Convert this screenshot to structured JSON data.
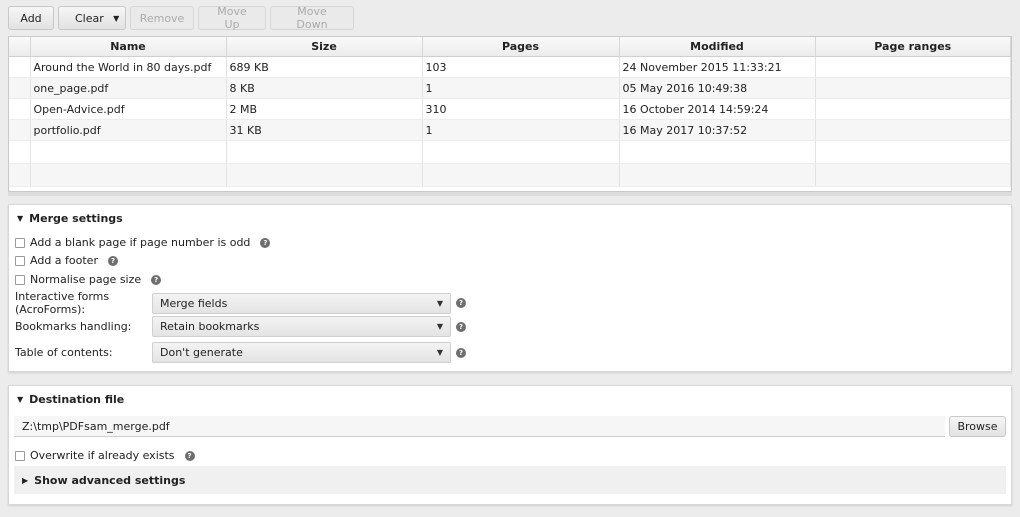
{
  "toolbar": {
    "add": "Add",
    "clear": "Clear",
    "remove": "Remove",
    "move_up": "Move Up",
    "move_down": "Move Down"
  },
  "table": {
    "columns": [
      "Name",
      "Size",
      "Pages",
      "Modified",
      "Page ranges"
    ],
    "rows": [
      {
        "name": "Around the World in 80 days.pdf",
        "size": "689 KB",
        "pages": "103",
        "modified": "24 November 2015 11:33:21",
        "ranges": ""
      },
      {
        "name": "one_page.pdf",
        "size": "8 KB",
        "pages": "1",
        "modified": "05 May 2016 10:49:38",
        "ranges": ""
      },
      {
        "name": "Open-Advice.pdf",
        "size": "2 MB",
        "pages": "310",
        "modified": "16 October 2014 14:59:24",
        "ranges": ""
      },
      {
        "name": "portfolio.pdf",
        "size": "31 KB",
        "pages": "1",
        "modified": "16 May 2017 10:37:52",
        "ranges": ""
      }
    ]
  },
  "merge": {
    "title": "Merge settings",
    "blank_page": "Add a blank page if page number is odd",
    "footer": "Add a footer",
    "normalise": "Normalise page size",
    "forms_label": "Interactive forms (AcroForms):",
    "forms_value": "Merge fields",
    "bookmarks_label": "Bookmarks handling:",
    "bookmarks_value": "Retain bookmarks",
    "toc_label": "Table of contents:",
    "toc_value": "Don't generate"
  },
  "destination": {
    "title": "Destination file",
    "path": "Z:\\tmp\\PDFsam_merge.pdf",
    "browse": "Browse",
    "overwrite": "Overwrite if already exists",
    "advanced": "Show advanced settings"
  },
  "icons": {
    "help": "?",
    "expand_down": "▼",
    "expand_right": "▶",
    "dropdown": "▼"
  }
}
